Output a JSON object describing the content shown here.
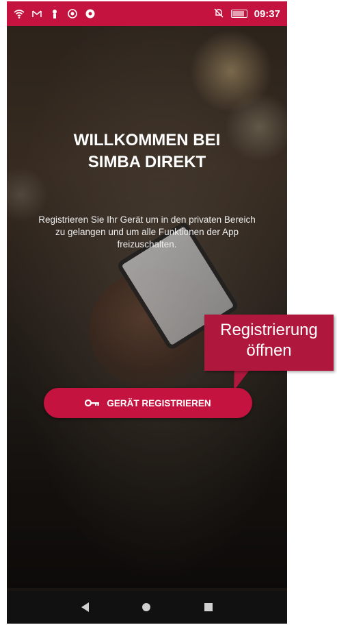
{
  "status_bar": {
    "battery": "99",
    "time": "09:37",
    "icons": [
      "wifi-icon",
      "gmail-icon",
      "notification-icon",
      "app-icon",
      "chrome-icon",
      "mute-icon",
      "battery-icon"
    ]
  },
  "welcome": {
    "title_line1": "WILLKOMMEN BEI",
    "title_line2": "SIMBA DIREKT",
    "description": "Registrieren Sie Ihr Gerät um in den privaten Bereich zu gelangen und um alle Funktionen der App freizuschalten."
  },
  "register_button": {
    "label": "GERÄT REGISTRIEREN",
    "icon": "key-icon"
  },
  "callout": {
    "line1": "Registrierung",
    "line2": "öffnen"
  },
  "nav_bar": {
    "buttons": [
      "back",
      "home",
      "recents"
    ]
  },
  "colors": {
    "accent": "#c4133f",
    "callout": "#b0173d",
    "nav_bar": "#111111"
  }
}
